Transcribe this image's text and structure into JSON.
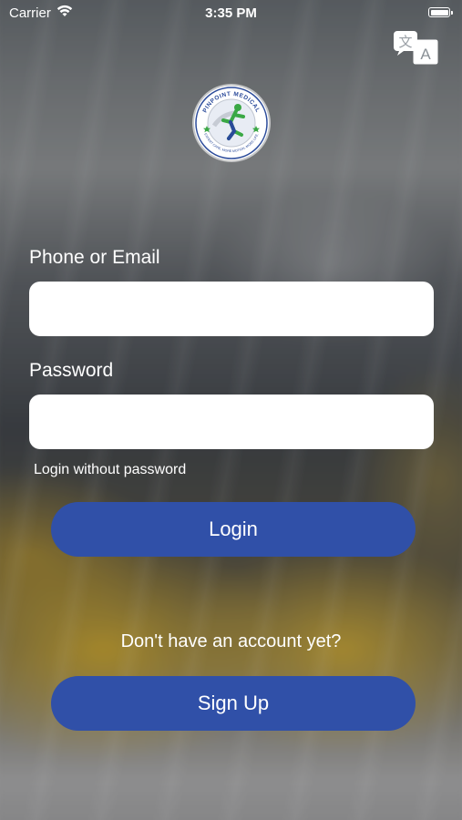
{
  "status_bar": {
    "carrier": "Carrier",
    "time": "3:35 PM",
    "icons": [
      "wifi-icon",
      "battery-icon"
    ]
  },
  "header": {
    "translate_icon": "translate-icon"
  },
  "logo": {
    "text_top": "PINPOINT MEDICAL",
    "text_bottom": "EXPERT CARE. MORE MOTION. MORE LIFE."
  },
  "form": {
    "phone_label": "Phone or Email",
    "phone_value": "",
    "password_label": "Password",
    "password_value": "",
    "login_without_password": "Login without password",
    "login_label": "Login"
  },
  "signup": {
    "prompt": "Don't have an account yet?",
    "button_label": "Sign Up"
  },
  "colors": {
    "button_bg": "#3050a8",
    "logo_blue": "#2a4a9a",
    "logo_green": "#3aa845"
  }
}
